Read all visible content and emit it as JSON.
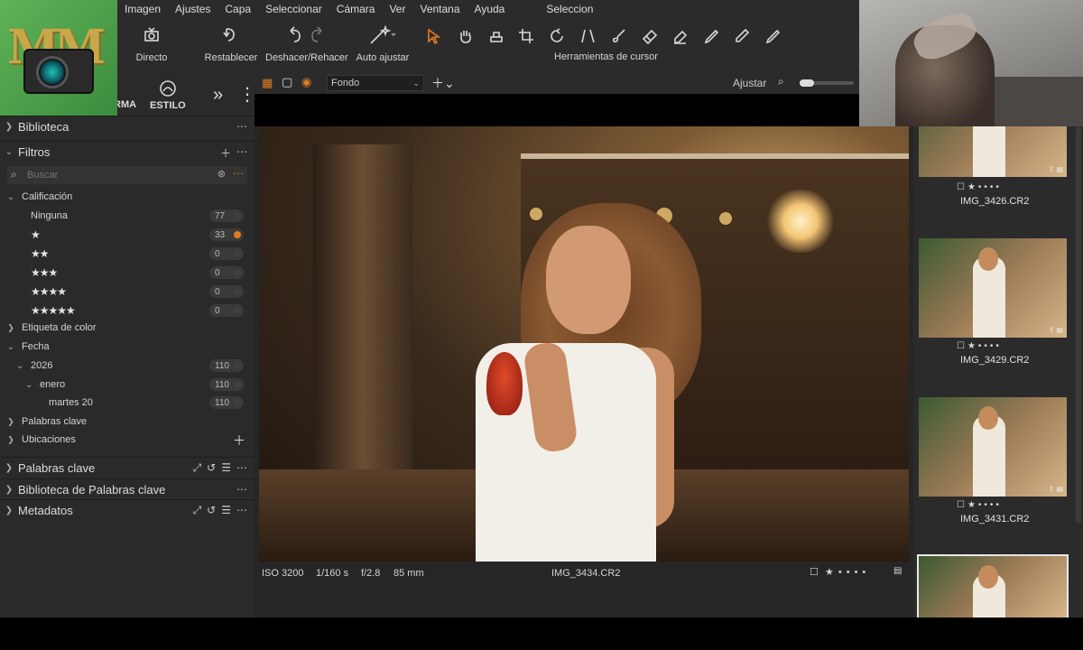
{
  "menu": {
    "items": [
      "Imagen",
      "Ajustes",
      "Capa",
      "Seleccionar",
      "Cámara",
      "Ver",
      "Ventana",
      "Ayuda"
    ],
    "selection": "Seleccion"
  },
  "toolbar": {
    "directo": "Directo",
    "restablecer": "Restablecer",
    "deshacer": "Deshacer/Rehacer",
    "auto_ajustar": "Auto ajustar",
    "cursor_tools_label": "Herramientas de cursor"
  },
  "logo": {
    "text": "MM"
  },
  "tool_tabs": {
    "forma": "RMA",
    "estilo": "ESTILO"
  },
  "viewer": {
    "fondo": "Fondo",
    "ajustar": "Ajustar",
    "iso": "ISO 3200",
    "shutter": "1/160 s",
    "aperture": "f/2.8",
    "focal": "85 mm",
    "filename": "IMG_3434.CR2"
  },
  "sections": {
    "biblioteca": "Biblioteca",
    "filtros": "Filtros",
    "search_placeholder": "Buscar",
    "calificacion": "Calificación",
    "ninguna": "Ninguna",
    "etiqueta_color": "Etiqueta de color",
    "fecha": "Fecha",
    "year": "2026",
    "month": "enero",
    "day": "martes 20",
    "palabras_clave_filter": "Palabras clave",
    "ubicaciones": "Ubicaciones",
    "palabras_clave": "Palabras clave",
    "biblioteca_palabras": "Biblioteca de Palabras clave",
    "metadatos": "Metadatos"
  },
  "counts": {
    "ninguna": "77",
    "one_star": "33",
    "two_star": "0",
    "three_star": "0",
    "four_star": "0",
    "five_star": "0",
    "year": "110",
    "month": "110",
    "day": "110"
  },
  "thumbnails": [
    {
      "name": "IMG_3426.CR2"
    },
    {
      "name": "IMG_3429.CR2"
    },
    {
      "name": "IMG_3431.CR2"
    },
    {
      "name": "IMG_3434.CR2"
    }
  ],
  "colors": {
    "accent": "#e07b22",
    "panel": "#2a2a2a"
  }
}
